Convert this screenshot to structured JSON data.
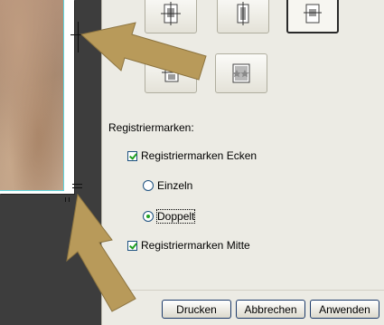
{
  "registration": {
    "section_label": "Registriermarken:",
    "corners_checkbox": {
      "label": "Registriermarken Ecken",
      "checked": true
    },
    "single_radio": {
      "label": "Einzeln",
      "checked": false
    },
    "double_radio": {
      "label": "Doppelt",
      "checked": true
    },
    "middle_checkbox": {
      "label": "Registriermarken Mitte",
      "checked": true
    }
  },
  "buttons": {
    "print": "Drucken",
    "cancel": "Abbrechen",
    "apply": "Anwenden"
  },
  "layout_options": [
    {
      "icon": "page-layout-icon"
    },
    {
      "icon": "page-layout-icon"
    },
    {
      "icon": "page-layout-icon",
      "selected": true
    },
    {
      "icon": "page-layout-icon"
    },
    {
      "icon": "page-layout-icon"
    }
  ],
  "colors": {
    "arrow": "#b89a5a",
    "preview_background": "#3d3d3d",
    "dialog_background": "#ecebe4",
    "check_green": "#21a121"
  }
}
